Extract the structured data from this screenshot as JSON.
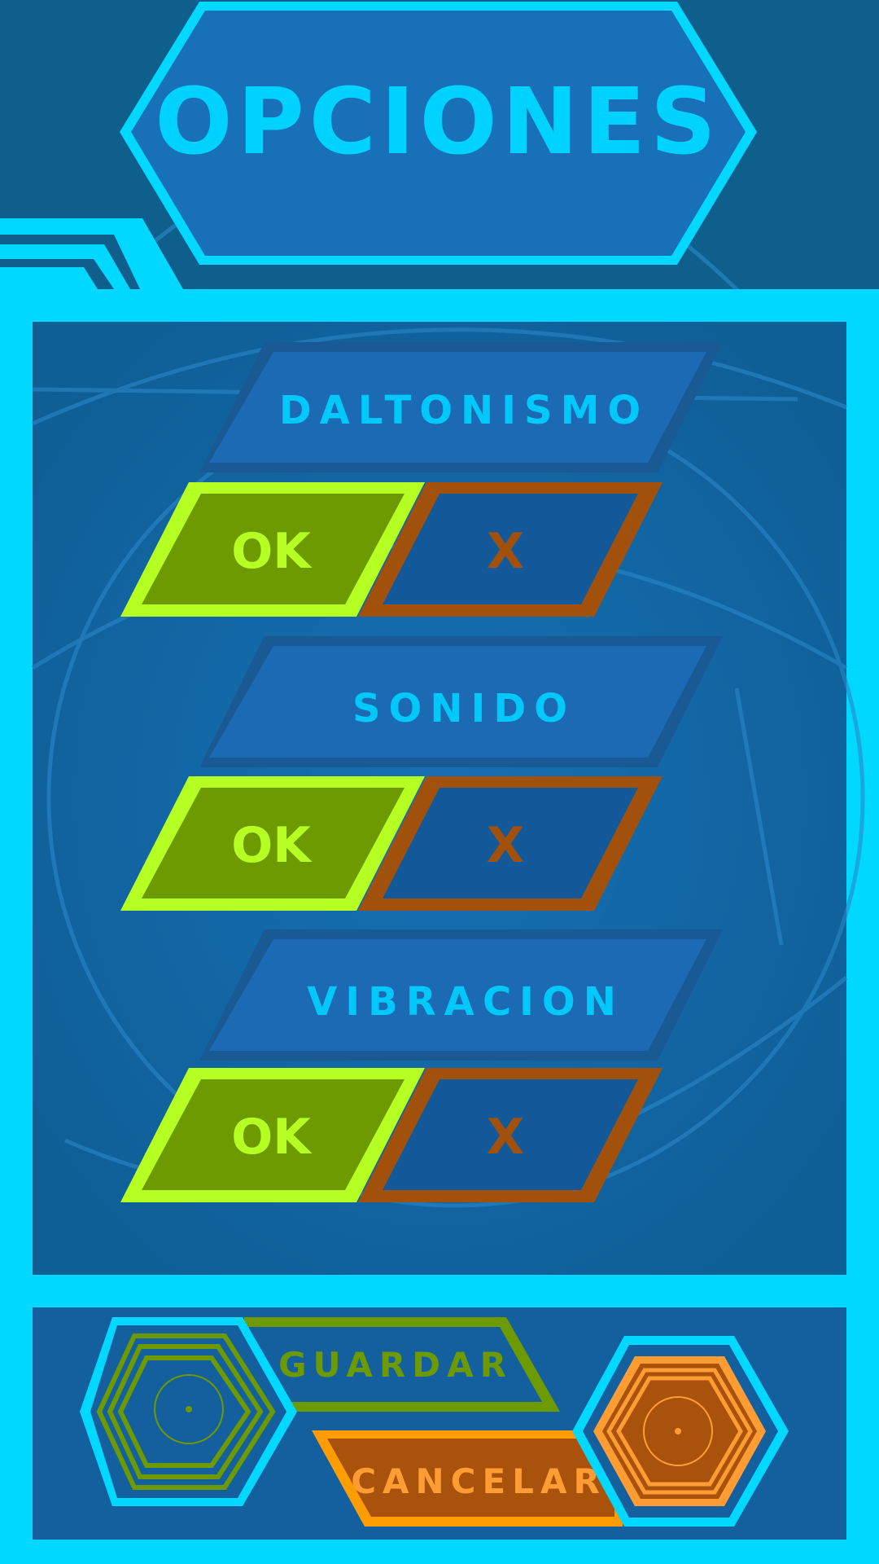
{
  "screen": {
    "title": "OPCIONES"
  },
  "options": [
    {
      "label": "DALTONISMO",
      "ok_label": "OK",
      "x_label": "X"
    },
    {
      "label": "SONIDO",
      "ok_label": "OK",
      "x_label": "X"
    },
    {
      "label": "VIBRACION",
      "ok_label": "OK",
      "x_label": "X"
    }
  ],
  "footer": {
    "save_label": "GUARDAR",
    "cancel_label": "CANCELAR"
  },
  "colors": {
    "background": "#0e5f8c",
    "panel_frame": "#00d8ff",
    "panel_fill": "#1667ab",
    "title_text": "#00d2ff",
    "ok_fill": "#6d9a00",
    "ok_stroke": "#b5ff22",
    "x_fill": "#13599a",
    "x_stroke": "#a2510c",
    "save_color": "#6d9a00",
    "cancel_fill": "#a8520b",
    "cancel_accent": "#ff9c33"
  }
}
